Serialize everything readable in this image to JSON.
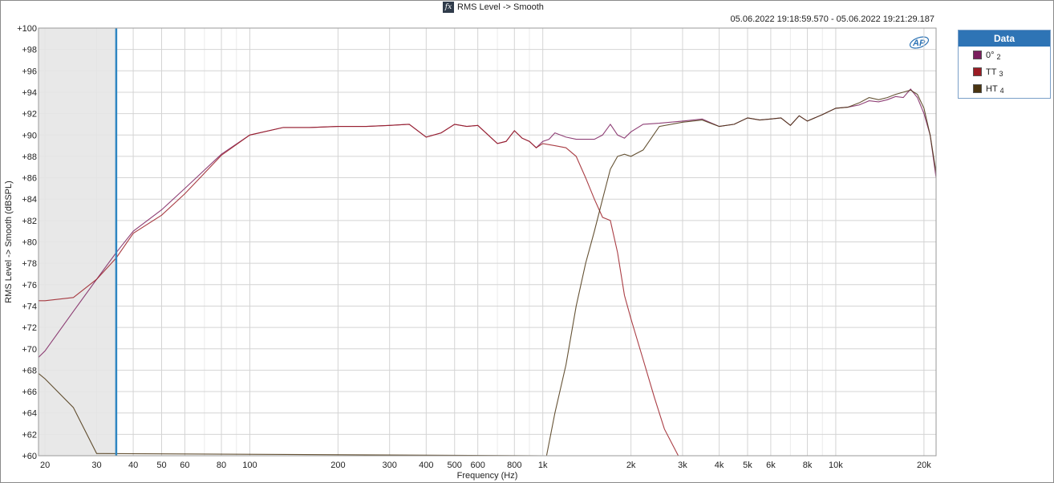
{
  "header": {
    "icon": "fx-icon",
    "title": "RMS Level -> Smooth",
    "timestamp": "05.06.2022 19:18:59.570 - 05.06.2022 19:21:29.187"
  },
  "legend": {
    "title": "Data",
    "items": [
      {
        "label": "0° 2",
        "name": "0°",
        "index": "2",
        "color": "#7b1f5e"
      },
      {
        "label": "TT 3",
        "name": "TT",
        "index": "3",
        "color": "#9b1c24"
      },
      {
        "label": "HT 4",
        "name": "HT",
        "index": "4",
        "color": "#4a3410"
      }
    ]
  },
  "logo": "AP",
  "chart_data": {
    "type": "line",
    "title": "RMS Level -> Smooth",
    "xlabel": "Frequency (Hz)",
    "ylabel": "RMS Level -> Smooth (dBSPL)",
    "x_scale": "log",
    "xlim": [
      19,
      22000
    ],
    "ylim": [
      60,
      100
    ],
    "grid": true,
    "legend_position": "right",
    "x_ticks": [
      {
        "v": 20,
        "label": "20"
      },
      {
        "v": 30,
        "label": "30"
      },
      {
        "v": 40,
        "label": "40"
      },
      {
        "v": 50,
        "label": "50"
      },
      {
        "v": 60,
        "label": "60"
      },
      {
        "v": 80,
        "label": "80"
      },
      {
        "v": 100,
        "label": "100"
      },
      {
        "v": 200,
        "label": "200"
      },
      {
        "v": 300,
        "label": "300"
      },
      {
        "v": 400,
        "label": "400"
      },
      {
        "v": 500,
        "label": "500"
      },
      {
        "v": 600,
        "label": "600"
      },
      {
        "v": 800,
        "label": "800"
      },
      {
        "v": 1000,
        "label": "1k"
      },
      {
        "v": 2000,
        "label": "2k"
      },
      {
        "v": 3000,
        "label": "3k"
      },
      {
        "v": 4000,
        "label": "4k"
      },
      {
        "v": 5000,
        "label": "5k"
      },
      {
        "v": 6000,
        "label": "6k"
      },
      {
        "v": 8000,
        "label": "8k"
      },
      {
        "v": 10000,
        "label": "10k"
      },
      {
        "v": 20000,
        "label": "20k"
      }
    ],
    "y_ticks": [
      {
        "v": 60,
        "label": "+60"
      },
      {
        "v": 62,
        "label": "+62"
      },
      {
        "v": 64,
        "label": "+64"
      },
      {
        "v": 66,
        "label": "+66"
      },
      {
        "v": 68,
        "label": "+68"
      },
      {
        "v": 70,
        "label": "+70"
      },
      {
        "v": 72,
        "label": "+72"
      },
      {
        "v": 74,
        "label": "+74"
      },
      {
        "v": 76,
        "label": "+76"
      },
      {
        "v": 78,
        "label": "+78"
      },
      {
        "v": 80,
        "label": "+80"
      },
      {
        "v": 82,
        "label": "+82"
      },
      {
        "v": 84,
        "label": "+84"
      },
      {
        "v": 86,
        "label": "+86"
      },
      {
        "v": 88,
        "label": "+88"
      },
      {
        "v": 90,
        "label": "+90"
      },
      {
        "v": 92,
        "label": "+92"
      },
      {
        "v": 94,
        "label": "+94"
      },
      {
        "v": 96,
        "label": "+96"
      },
      {
        "v": 98,
        "label": "+98"
      },
      {
        "v": 100,
        "label": "+100"
      }
    ],
    "marker_frequency": 35,
    "shaded_region": [
      19,
      35
    ],
    "series": [
      {
        "name": "0° 2",
        "color": "#7b1f5e",
        "x": [
          19,
          20,
          25,
          30,
          35,
          40,
          50,
          60,
          80,
          100,
          130,
          160,
          200,
          250,
          300,
          350,
          400,
          450,
          500,
          550,
          600,
          700,
          750,
          800,
          850,
          900,
          950,
          1000,
          1050,
          1100,
          1200,
          1300,
          1400,
          1500,
          1600,
          1700,
          1800,
          1900,
          2000,
          2200,
          2500,
          3000,
          3500,
          4000,
          4500,
          5000,
          5500,
          6000,
          6500,
          7000,
          7500,
          8000,
          9000,
          10000,
          11000,
          12000,
          13000,
          14000,
          15000,
          16000,
          17000,
          18000,
          19000,
          20000,
          21000,
          22000
        ],
        "y": [
          69.2,
          69.8,
          73.5,
          76.5,
          79,
          81,
          83,
          85,
          88.2,
          90,
          90.7,
          90.7,
          90.8,
          90.8,
          90.9,
          91,
          89.8,
          90.2,
          91,
          90.8,
          90.9,
          89.2,
          89.4,
          90.4,
          89.7,
          89.4,
          88.8,
          89.4,
          89.6,
          90.2,
          89.8,
          89.6,
          89.6,
          89.6,
          90,
          91,
          90,
          89.7,
          90.3,
          91,
          91.1,
          91.3,
          91.5,
          90.8,
          91,
          91.6,
          91.4,
          91.5,
          91.6,
          90.9,
          91.8,
          91.3,
          91.9,
          92.5,
          92.6,
          92.8,
          93.2,
          93.1,
          93.3,
          93.6,
          93.5,
          94.3,
          93.5,
          92,
          90,
          86
        ]
      },
      {
        "name": "TT 3",
        "color": "#9b1c24",
        "x": [
          19,
          20,
          25,
          30,
          35,
          40,
          50,
          60,
          80,
          100,
          130,
          160,
          200,
          250,
          300,
          350,
          400,
          450,
          500,
          550,
          600,
          700,
          750,
          800,
          850,
          900,
          950,
          1000,
          1100,
          1200,
          1300,
          1400,
          1500,
          1600,
          1700,
          1800,
          1900,
          2000,
          2200,
          2400,
          2600,
          2800,
          2900
        ],
        "y": [
          74.5,
          74.5,
          74.8,
          76.5,
          78.5,
          80.8,
          82.5,
          84.5,
          88.1,
          90,
          90.7,
          90.7,
          90.8,
          90.8,
          90.9,
          91,
          89.8,
          90.2,
          91,
          90.8,
          90.9,
          89.2,
          89.4,
          90.4,
          89.7,
          89.4,
          88.8,
          89.2,
          89,
          88.8,
          88,
          86,
          84,
          82.3,
          82,
          79,
          75,
          72.8,
          69,
          65.5,
          62.5,
          60.8,
          60
        ]
      },
      {
        "name": "HT 4",
        "color": "#4a3410",
        "x": [
          19,
          20,
          25,
          30,
          1030,
          1100,
          1200,
          1300,
          1400,
          1500,
          1600,
          1700,
          1800,
          1900,
          2000,
          2200,
          2500,
          3000,
          3500,
          4000,
          4500,
          5000,
          5500,
          6000,
          6500,
          7000,
          7500,
          8000,
          9000,
          10000,
          11000,
          12000,
          13000,
          14000,
          15000,
          16000,
          17000,
          18000,
          19000,
          20000,
          21000,
          22000
        ],
        "y": [
          67.7,
          67.2,
          64.5,
          60.2,
          60,
          64,
          68.5,
          74,
          78,
          81,
          84,
          86.8,
          88,
          88.2,
          88,
          88.6,
          90.8,
          91.2,
          91.4,
          90.8,
          91,
          91.6,
          91.4,
          91.5,
          91.6,
          90.9,
          91.8,
          91.3,
          91.9,
          92.5,
          92.6,
          93,
          93.5,
          93.3,
          93.5,
          93.8,
          94,
          94.2,
          93.8,
          92.5,
          90,
          86.5
        ]
      }
    ]
  }
}
